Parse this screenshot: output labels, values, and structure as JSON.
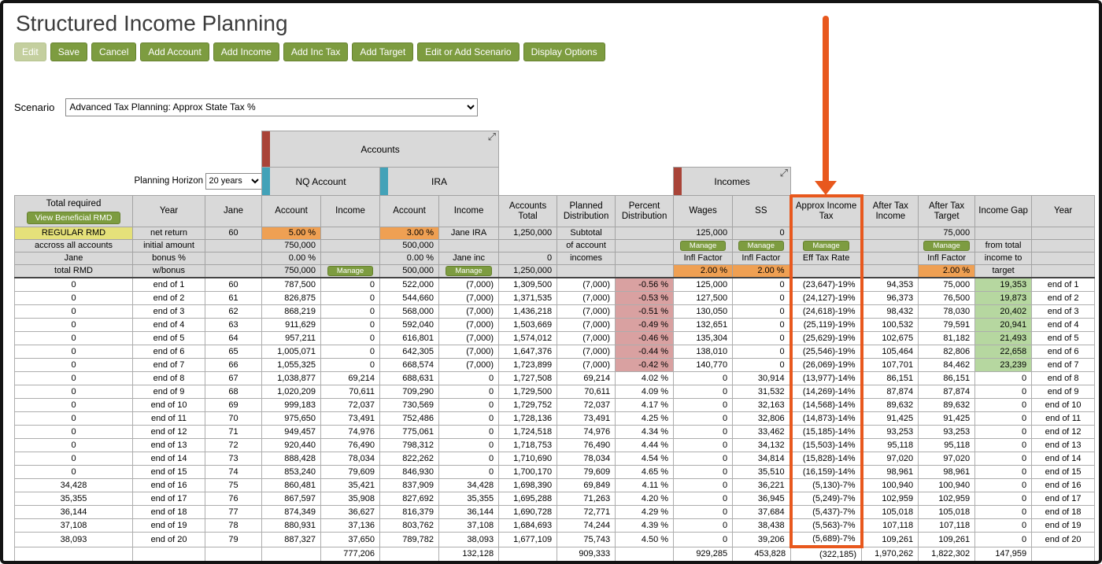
{
  "title": "Structured Income Planning",
  "toolbar": [
    {
      "label": "Edit",
      "disabled": true
    },
    {
      "label": "Save"
    },
    {
      "label": "Cancel"
    },
    {
      "label": "Add Account"
    },
    {
      "label": "Add Income"
    },
    {
      "label": "Add Inc Tax"
    },
    {
      "label": "Add Target"
    },
    {
      "label": "Edit or Add Scenario"
    },
    {
      "label": "Display Options"
    }
  ],
  "scenario": {
    "label": "Scenario",
    "value": "Advanced Tax Planning: Approx State Tax %"
  },
  "planning_horizon": {
    "label": "Planning Horizon",
    "value": "20 years"
  },
  "group_headers": {
    "accounts": "Accounts",
    "nq_account": "NQ Account",
    "ira": "IRA",
    "incomes": "Incomes"
  },
  "table": {
    "columns": [
      "Total required",
      "Year",
      "Jane",
      "Account",
      "Income",
      "Account",
      "Income",
      "Accounts Total",
      "Planned Distribution",
      "Percent Distribution",
      "Wages",
      "SS",
      "Approx Income Tax",
      "After Tax Income",
      "After Tax Target",
      "Income Gap",
      "Year"
    ],
    "left_header_button": "View Beneficial RMD",
    "config_rows": [
      [
        {
          "t": "REGULAR RMD",
          "k": "y"
        },
        {
          "t": "net return",
          "k": "c"
        },
        {
          "t": "60",
          "k": "c"
        },
        {
          "t": "5.00 %",
          "k": "o"
        },
        {
          "t": "",
          "k": ""
        },
        {
          "t": "3.00 %",
          "k": "o"
        },
        {
          "t": "Jane IRA",
          "k": "c"
        },
        {
          "t": "1,250,000",
          "k": "r"
        },
        {
          "t": "Subtotal",
          "k": "c"
        },
        {
          "t": "",
          "k": ""
        },
        {
          "t": "125,000",
          "k": "r"
        },
        {
          "t": "0",
          "k": "r"
        },
        {
          "t": "",
          "k": ""
        },
        {
          "t": "",
          "k": ""
        },
        {
          "t": "75,000",
          "k": "r"
        },
        {
          "t": "",
          "k": ""
        },
        {
          "t": "",
          "k": ""
        }
      ],
      [
        {
          "t": "accross all accounts",
          "k": "c"
        },
        {
          "t": "initial amount",
          "k": "c"
        },
        {
          "t": "",
          "k": ""
        },
        {
          "t": "750,000",
          "k": "r"
        },
        {
          "t": "",
          "k": ""
        },
        {
          "t": "500,000",
          "k": "r"
        },
        {
          "t": "",
          "k": ""
        },
        {
          "t": "",
          "k": ""
        },
        {
          "t": "of account",
          "k": "c"
        },
        {
          "t": "",
          "k": ""
        },
        {
          "t": "Manage",
          "k": "b"
        },
        {
          "t": "Manage",
          "k": "b"
        },
        {
          "t": "Manage",
          "k": "b"
        },
        {
          "t": "",
          "k": ""
        },
        {
          "t": "Manage",
          "k": "b"
        },
        {
          "t": "from total",
          "k": "c"
        },
        {
          "t": "",
          "k": ""
        }
      ],
      [
        {
          "t": "Jane",
          "k": "c"
        },
        {
          "t": "bonus %",
          "k": "c"
        },
        {
          "t": "",
          "k": ""
        },
        {
          "t": "0.00 %",
          "k": "r"
        },
        {
          "t": "",
          "k": ""
        },
        {
          "t": "0.00 %",
          "k": "r"
        },
        {
          "t": "Jane inc",
          "k": "c"
        },
        {
          "t": "0",
          "k": "r"
        },
        {
          "t": "incomes",
          "k": "c"
        },
        {
          "t": "",
          "k": ""
        },
        {
          "t": "Infl Factor",
          "k": "c"
        },
        {
          "t": "Infl Factor",
          "k": "c"
        },
        {
          "t": "Eff Tax Rate",
          "k": "c"
        },
        {
          "t": "",
          "k": ""
        },
        {
          "t": "Infl Factor",
          "k": "c"
        },
        {
          "t": "income to",
          "k": "c"
        },
        {
          "t": "",
          "k": ""
        }
      ],
      [
        {
          "t": "total RMD",
          "k": "c"
        },
        {
          "t": "w/bonus",
          "k": "c"
        },
        {
          "t": "",
          "k": ""
        },
        {
          "t": "750,000",
          "k": "r"
        },
        {
          "t": "Manage",
          "k": "b"
        },
        {
          "t": "500,000",
          "k": "r"
        },
        {
          "t": "Manage",
          "k": "b"
        },
        {
          "t": "1,250,000",
          "k": "r"
        },
        {
          "t": "",
          "k": ""
        },
        {
          "t": "",
          "k": ""
        },
        {
          "t": "2.00 %",
          "k": "o"
        },
        {
          "t": "2.00 %",
          "k": "o"
        },
        {
          "t": "",
          "k": ""
        },
        {
          "t": "",
          "k": ""
        },
        {
          "t": "2.00 %",
          "k": "o"
        },
        {
          "t": "target",
          "k": "c"
        },
        {
          "t": "",
          "k": ""
        }
      ]
    ],
    "rows": [
      [
        "0",
        "end of 1",
        "60",
        "787,500",
        "0",
        "522,000",
        "(7,000)",
        "1,309,500",
        "(7,000)",
        "-0.56 %",
        "125,000",
        "0",
        "(23,647)-19%",
        "94,353",
        "75,000",
        "19,353",
        "end of 1"
      ],
      [
        "0",
        "end of 2",
        "61",
        "826,875",
        "0",
        "544,660",
        "(7,000)",
        "1,371,535",
        "(7,000)",
        "-0.53 %",
        "127,500",
        "0",
        "(24,127)-19%",
        "96,373",
        "76,500",
        "19,873",
        "end of 2"
      ],
      [
        "0",
        "end of 3",
        "62",
        "868,219",
        "0",
        "568,000",
        "(7,000)",
        "1,436,218",
        "(7,000)",
        "-0.51 %",
        "130,050",
        "0",
        "(24,618)-19%",
        "98,432",
        "78,030",
        "20,402",
        "end of 3"
      ],
      [
        "0",
        "end of 4",
        "63",
        "911,629",
        "0",
        "592,040",
        "(7,000)",
        "1,503,669",
        "(7,000)",
        "-0.49 %",
        "132,651",
        "0",
        "(25,119)-19%",
        "100,532",
        "79,591",
        "20,941",
        "end of 4"
      ],
      [
        "0",
        "end of 5",
        "64",
        "957,211",
        "0",
        "616,801",
        "(7,000)",
        "1,574,012",
        "(7,000)",
        "-0.46 %",
        "135,304",
        "0",
        "(25,629)-19%",
        "102,675",
        "81,182",
        "21,493",
        "end of 5"
      ],
      [
        "0",
        "end of 6",
        "65",
        "1,005,071",
        "0",
        "642,305",
        "(7,000)",
        "1,647,376",
        "(7,000)",
        "-0.44 %",
        "138,010",
        "0",
        "(25,546)-19%",
        "105,464",
        "82,806",
        "22,658",
        "end of 6"
      ],
      [
        "0",
        "end of 7",
        "66",
        "1,055,325",
        "0",
        "668,574",
        "(7,000)",
        "1,723,899",
        "(7,000)",
        "-0.42 %",
        "140,770",
        "0",
        "(26,069)-19%",
        "107,701",
        "84,462",
        "23,239",
        "end of 7"
      ],
      [
        "0",
        "end of 8",
        "67",
        "1,038,877",
        "69,214",
        "688,631",
        "0",
        "1,727,508",
        "69,214",
        "4.02 %",
        "0",
        "30,914",
        "(13,977)-14%",
        "86,151",
        "86,151",
        "0",
        "end of 8"
      ],
      [
        "0",
        "end of 9",
        "68",
        "1,020,209",
        "70,611",
        "709,290",
        "0",
        "1,729,500",
        "70,611",
        "4.09 %",
        "0",
        "31,532",
        "(14,269)-14%",
        "87,874",
        "87,874",
        "0",
        "end of 9"
      ],
      [
        "0",
        "end of 10",
        "69",
        "999,183",
        "72,037",
        "730,569",
        "0",
        "1,729,752",
        "72,037",
        "4.17 %",
        "0",
        "32,163",
        "(14,568)-14%",
        "89,632",
        "89,632",
        "0",
        "end of 10"
      ],
      [
        "0",
        "end of 11",
        "70",
        "975,650",
        "73,491",
        "752,486",
        "0",
        "1,728,136",
        "73,491",
        "4.25 %",
        "0",
        "32,806",
        "(14,873)-14%",
        "91,425",
        "91,425",
        "0",
        "end of 11"
      ],
      [
        "0",
        "end of 12",
        "71",
        "949,457",
        "74,976",
        "775,061",
        "0",
        "1,724,518",
        "74,976",
        "4.34 %",
        "0",
        "33,462",
        "(15,185)-14%",
        "93,253",
        "93,253",
        "0",
        "end of 12"
      ],
      [
        "0",
        "end of 13",
        "72",
        "920,440",
        "76,490",
        "798,312",
        "0",
        "1,718,753",
        "76,490",
        "4.44 %",
        "0",
        "34,132",
        "(15,503)-14%",
        "95,118",
        "95,118",
        "0",
        "end of 13"
      ],
      [
        "0",
        "end of 14",
        "73",
        "888,428",
        "78,034",
        "822,262",
        "0",
        "1,710,690",
        "78,034",
        "4.54 %",
        "0",
        "34,814",
        "(15,828)-14%",
        "97,020",
        "97,020",
        "0",
        "end of 14"
      ],
      [
        "0",
        "end of 15",
        "74",
        "853,240",
        "79,609",
        "846,930",
        "0",
        "1,700,170",
        "79,609",
        "4.65 %",
        "0",
        "35,510",
        "(16,159)-14%",
        "98,961",
        "98,961",
        "0",
        "end of 15"
      ],
      [
        "34,428",
        "end of 16",
        "75",
        "860,481",
        "35,421",
        "837,909",
        "34,428",
        "1,698,390",
        "69,849",
        "4.11 %",
        "0",
        "36,221",
        "(5,130)-7%",
        "100,940",
        "100,940",
        "0",
        "end of 16"
      ],
      [
        "35,355",
        "end of 17",
        "76",
        "867,597",
        "35,908",
        "827,692",
        "35,355",
        "1,695,288",
        "71,263",
        "4.20 %",
        "0",
        "36,945",
        "(5,249)-7%",
        "102,959",
        "102,959",
        "0",
        "end of 17"
      ],
      [
        "36,144",
        "end of 18",
        "77",
        "874,349",
        "36,627",
        "816,379",
        "36,144",
        "1,690,728",
        "72,771",
        "4.29 %",
        "0",
        "37,684",
        "(5,437)-7%",
        "105,018",
        "105,018",
        "0",
        "end of 18"
      ],
      [
        "37,108",
        "end of 19",
        "78",
        "880,931",
        "37,136",
        "803,762",
        "37,108",
        "1,684,693",
        "74,244",
        "4.39 %",
        "0",
        "38,438",
        "(5,563)-7%",
        "107,118",
        "107,118",
        "0",
        "end of 19"
      ],
      [
        "38,093",
        "end of 20",
        "79",
        "887,327",
        "37,650",
        "789,782",
        "38,093",
        "1,677,109",
        "75,743",
        "4.50 %",
        "0",
        "39,206",
        "(5,689)-7%",
        "109,261",
        "109,261",
        "0",
        "end of 20"
      ]
    ],
    "totals": [
      "",
      "",
      "",
      "",
      "777,206",
      "",
      "132,128",
      "",
      "909,333",
      "",
      "929,285",
      "453,828",
      "(322,185)",
      "1,970,262",
      "1,822,302",
      "147,959",
      ""
    ]
  },
  "colors": {
    "accent_green": "#7D9C40",
    "header_gray": "#D9D9D9",
    "rmd_yellow": "#E5E17A",
    "config_orange": "#EFA053",
    "negative_pink": "#D9A1A1",
    "gap_green": "#B6D7A0",
    "highlight_orange": "#E8581D",
    "accounts_tab_maroon": "#A94438",
    "account_tab_teal": "#43A2B8"
  }
}
